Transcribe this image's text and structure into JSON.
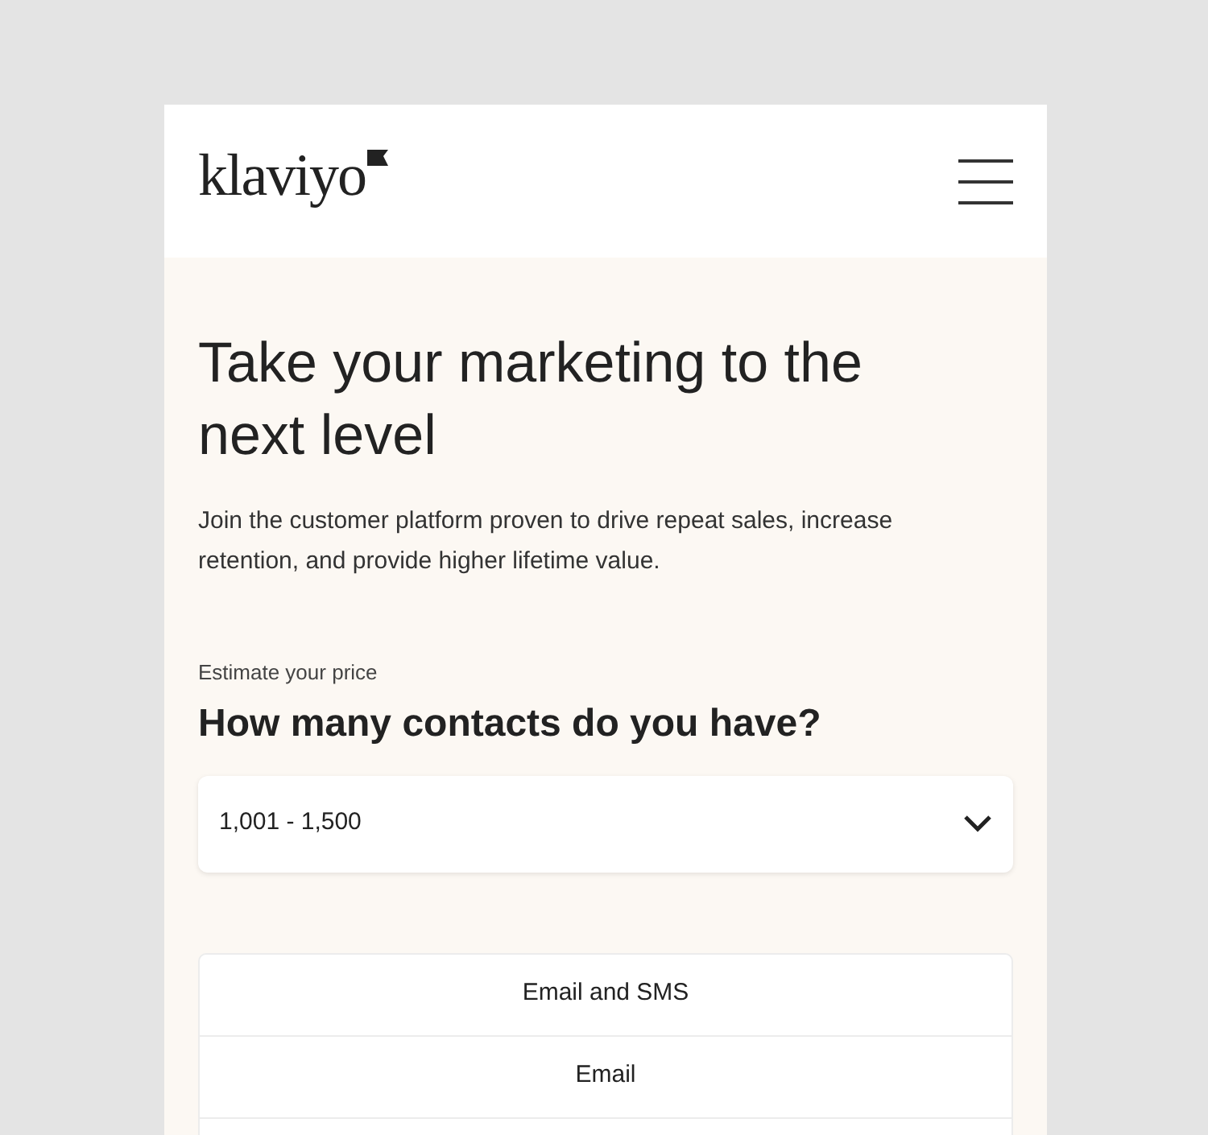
{
  "header": {
    "logo": "klaviyo"
  },
  "hero": {
    "title": "Take your marketing to the next level",
    "subtitle": "Join the customer platform proven to drive repeat sales, increase retention, and provide higher lifetime value."
  },
  "pricing": {
    "eyebrow": "Estimate your price",
    "question": "How many contacts do you have?",
    "contacts_select": {
      "value": "1,001 - 1,500"
    },
    "options": [
      {
        "label": "Email and SMS"
      },
      {
        "label": "Email"
      }
    ]
  }
}
